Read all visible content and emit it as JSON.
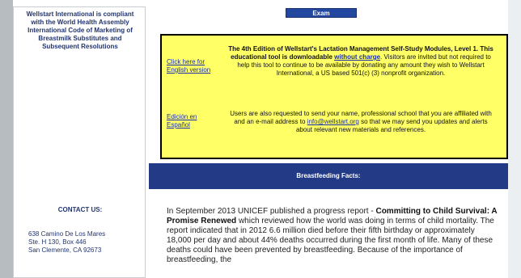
{
  "sidebar": {
    "compliance_text": "Wellstart International is compliant with the World Health Assembly International Code of Marketing of Breastmilk Substitutes and Subsequent Resolutions",
    "contact_title": "CONTACT US:",
    "address": [
      "638 Camino De Los Mares",
      "Ste. H 130, Box 446",
      "San Clemente, CA 92673"
    ]
  },
  "main": {
    "exam_button": "Exam",
    "yellow_box": {
      "english_link": "Click here for English version",
      "spanish_link": "Edición en Español",
      "heading_bold": "The 4th Edition of Wellstart's Lactation Management Self-Study Modules, Level 1. This educational tool is downloadable",
      "without_change_link": "without charge",
      "heading_rest": ". Visitors are invited but not required to help this tool to continue to be available by donating any amount they wish to Wellstart International, a US based 501(c) (3) nonprofit organization.",
      "users_text_1": "Users are also requested to send your name, professional school that you are affiliated with and an e-mail address to",
      "email": "info@wellstart.org",
      "users_text_2": "so that we may send you updates and alerts about relevant new materials and references."
    },
    "facts_title": "Breastfeeding Facts:",
    "facts_paragraph": {
      "part1": "In September 2013 UNICEF published a progress report -",
      "report_title": "Committing to Child Survival: A Promise Renewed",
      "part2": "which reviewed how the world was doing in terms of child mortality. The report indicated that in 2012 6.6 million died before their fifth birthday or approximately 18,000 per day and about 44% deaths occurred during the first month of life. Many of these deaths could have been prevented by breastfeeding. Because of the importance of breastfeeding, the"
    }
  }
}
